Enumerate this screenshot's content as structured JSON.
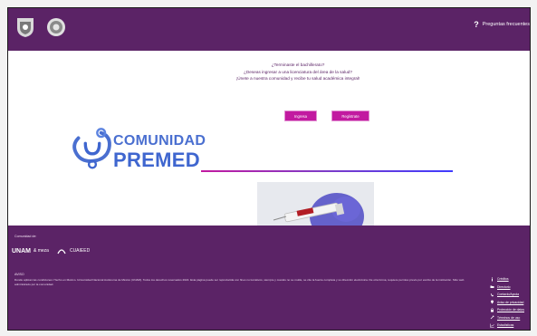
{
  "header": {
    "faq_icon": "?",
    "faq_label": "Preguntas frecuentes"
  },
  "hero": {
    "lines": [
      "¿Terminaste el bachillerato?",
      "¿Deseas ingresar a una licenciatura del área de la salud?",
      "¡Únete a nuestra comunidad y recibe tu salud académica integral!"
    ],
    "button_login": "Ingresa",
    "button_register": "Regístrate"
  },
  "brand": {
    "line1": "COMUNIDAD",
    "line2": "PREMED"
  },
  "footer": {
    "partners_heading": "Comunidad de:",
    "partner1": "UNAM",
    "partner1_sub": "& meza",
    "partner2": "CUAIEED",
    "aviso_title": "AVISO",
    "aviso_text": "Donde aplican las condiciones: Hecho en México. Universidad Nacional Autónoma de México (UNAM). Todos los derechos reservados 2022. Esta página puede ser reproducida con fines no lucrativos, siempre y cuando no se mutile, se cite la fuente completa y su dirección electrónica. De otra forma, requiere permiso previo por escrito de la institución. Sitio web administrado por la comunidad.",
    "links": [
      {
        "icon": "info-icon",
        "label": "Créditos"
      },
      {
        "icon": "folder-icon",
        "label": "Directorio"
      },
      {
        "icon": "phone-icon",
        "label": "Contacto/Ayuda"
      },
      {
        "icon": "location-icon",
        "label": "Aviso de privacidad"
      },
      {
        "icon": "lock-icon",
        "label": "Protección de datos"
      },
      {
        "icon": "tool-icon",
        "label": "Términos de uso"
      },
      {
        "icon": "chart-icon",
        "label": "Estadísticas"
      }
    ]
  },
  "colors": {
    "primary": "#5b2366",
    "accent": "#c21aa0",
    "brand_blue": "#3f66cf"
  }
}
